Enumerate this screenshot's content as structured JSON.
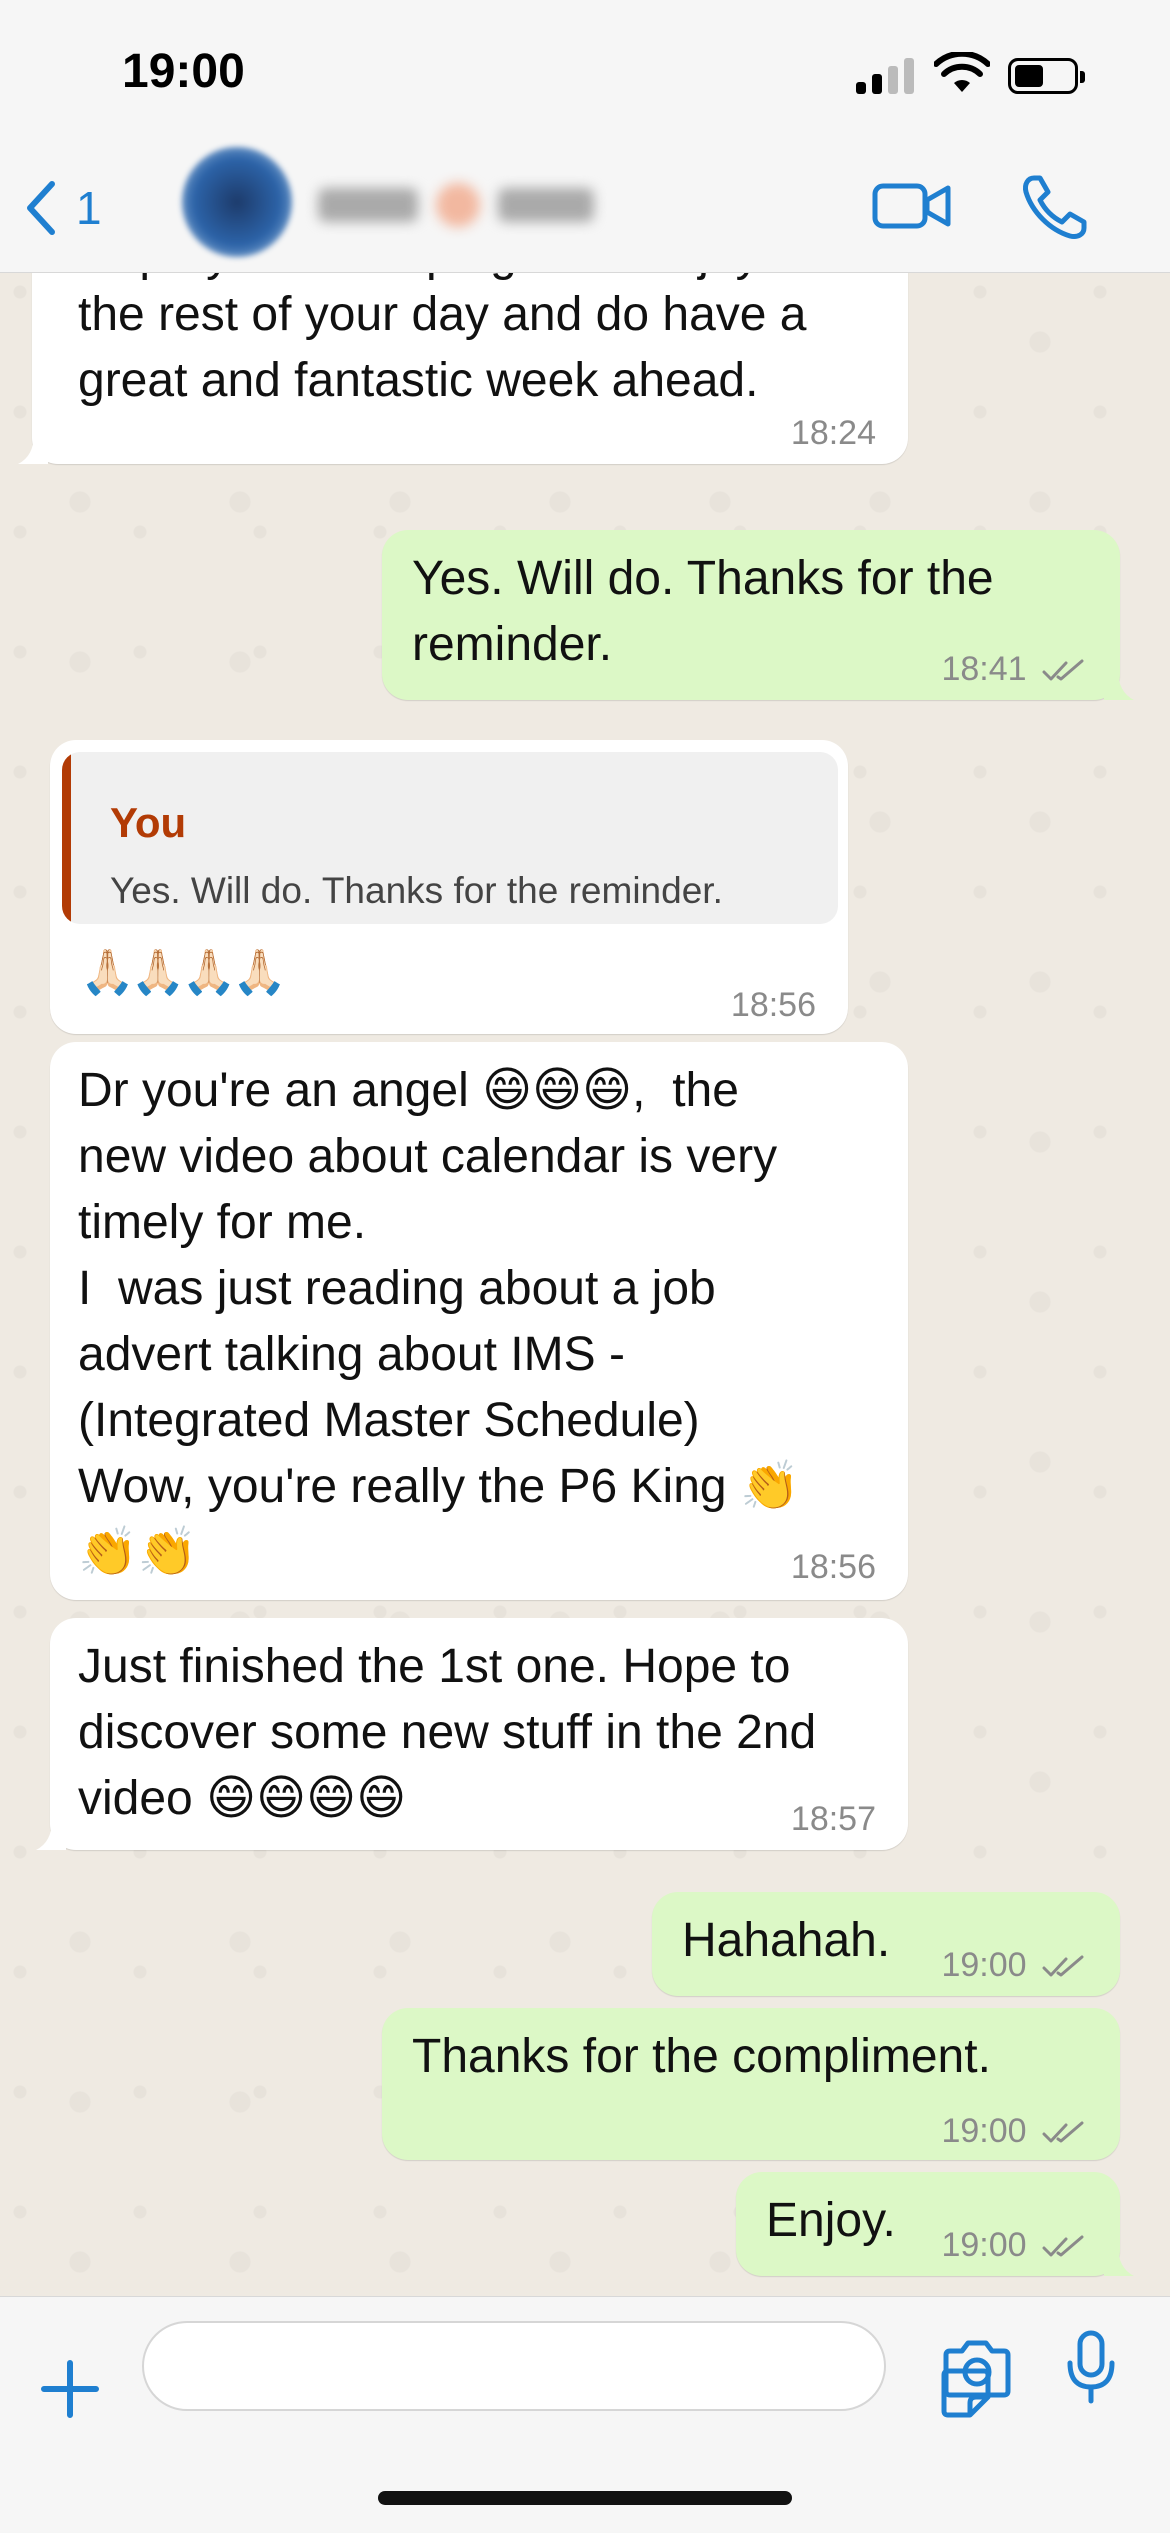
{
  "status_bar": {
    "time": "19:00"
  },
  "header": {
    "back_count": "1"
  },
  "messages": [
    {
      "direction": "in",
      "text": "the rest of your day and do have a\ngreat and fantastic week ahead.",
      "time": "18:24"
    },
    {
      "direction": "out",
      "text": "Yes. Will do. Thanks for the\nreminder.",
      "time": "18:41"
    },
    {
      "direction": "in",
      "quote_author": "You",
      "quote_text": "Yes. Will do. Thanks for the reminder.",
      "text": "🙏🏻🙏🏻🙏🏻🙏🏻",
      "time": "18:56"
    },
    {
      "direction": "in",
      "text": "Dr you're an angel 😄😄😄,  the\nnew video about calendar is very\ntimely for me.\nI  was just reading about a job\nadvert talking about IMS -\n(Integrated Master Schedule)\nWow, you're really the P6 King 👏\n👏👏",
      "time": "18:56"
    },
    {
      "direction": "in",
      "text": "Just finished the 1st one. Hope to\ndiscover some new stuff in the 2nd\nvideo 😄😄😄😄",
      "time": "18:57"
    },
    {
      "direction": "out",
      "text": "Hahahah.",
      "time": "19:00"
    },
    {
      "direction": "out",
      "text": "Thanks for the compliment.",
      "time": "19:00"
    },
    {
      "direction": "out",
      "text": "Enjoy.",
      "time": "19:00"
    }
  ],
  "colors": {
    "accent": "#1F7FD0",
    "outgoing_bubble": "#DCF8C6",
    "incoming_bubble": "#FFFFFF",
    "quote_author": "#B23B05"
  },
  "icons": [
    "back-chevron-icon",
    "video-call-icon",
    "phone-icon",
    "plus-icon",
    "sticker-icon",
    "camera-icon",
    "microphone-icon"
  ]
}
